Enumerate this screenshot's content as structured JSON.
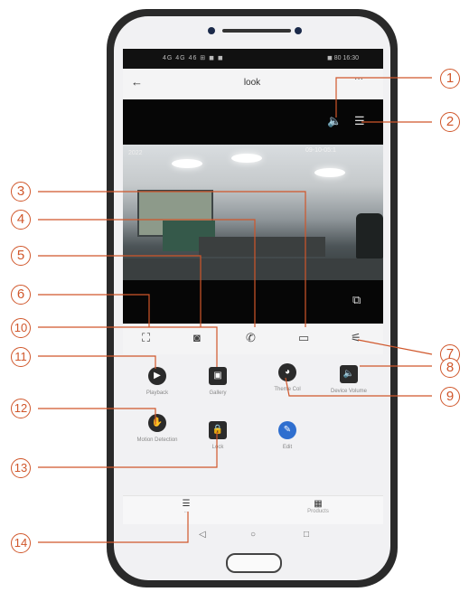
{
  "status_bar": {
    "left": "4G 4G 46 ⊞ ◼ ◼",
    "right": "◼ 80 16:30"
  },
  "header": {
    "back_glyph": "←",
    "title": "look",
    "more_glyph": "···"
  },
  "video": {
    "timestamp": "09-10-05:1",
    "corner_label": "2022"
  },
  "top_controls": {
    "volume_glyph": "🔈",
    "menu_glyph": "☰"
  },
  "bottom_controls": {
    "layout_glyph": "⧉"
  },
  "control_bar": [
    {
      "name": "fullscreen",
      "glyph": "⛶"
    },
    {
      "name": "snapshot",
      "glyph": "◙"
    },
    {
      "name": "talk",
      "glyph": "✆"
    },
    {
      "name": "record",
      "glyph": "▭"
    },
    {
      "name": "ptz",
      "glyph": "⚟"
    }
  ],
  "functions": [
    {
      "label": "Playback",
      "glyph": "▶",
      "icon": "playback-icon"
    },
    {
      "label": "Gallery",
      "glyph": "▣",
      "icon": "gallery-icon"
    },
    {
      "label": "Theme Col",
      "glyph": "◕",
      "icon": "theme-color-icon"
    },
    {
      "label": "Device Volume",
      "glyph": "🔈",
      "icon": "volume-icon"
    },
    {
      "label": "Motion Detection",
      "glyph": "✋",
      "icon": "motion-icon"
    },
    {
      "label": "Lock",
      "glyph": "🔒",
      "icon": "lock-icon"
    },
    {
      "label": "Edit",
      "glyph": "✎",
      "icon": "edit-icon"
    }
  ],
  "tabs": [
    {
      "label": "...",
      "glyph": "☰"
    },
    {
      "label": "Products",
      "glyph": "▦"
    }
  ],
  "nav": {
    "back": "◁",
    "home": "○",
    "recent": "□"
  },
  "callouts": [
    "1",
    "2",
    "3",
    "4",
    "5",
    "6",
    "7",
    "8",
    "9",
    "10",
    "11",
    "12",
    "13",
    "14"
  ],
  "colors": {
    "callout": "#d0562a",
    "phone_body": "#2a2a2a",
    "edit_accent": "#2f6fcf"
  }
}
